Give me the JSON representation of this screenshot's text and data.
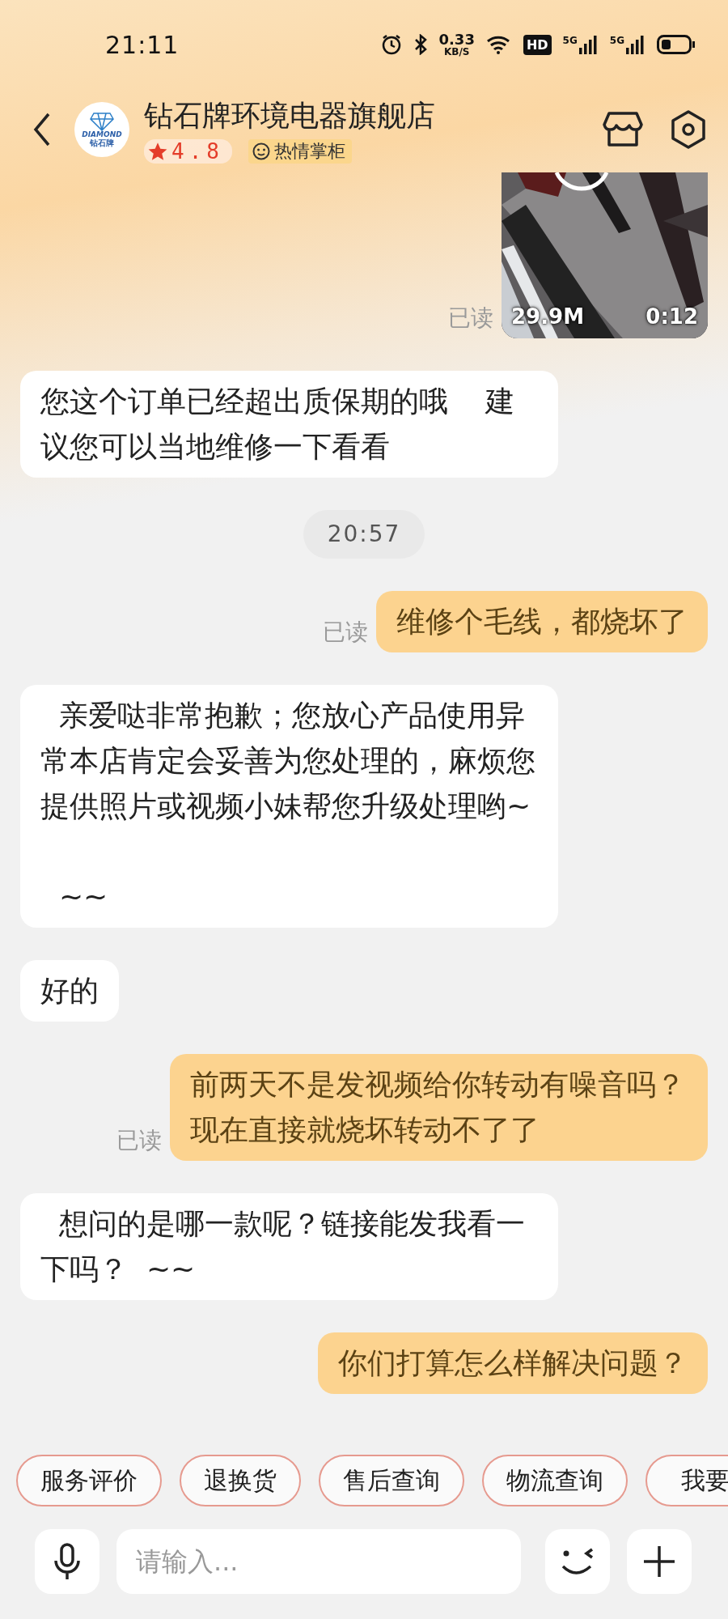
{
  "status_bar": {
    "time": "21:11",
    "speed": "0.33",
    "speed_unit": "KB/S",
    "hd": "HD",
    "networks": [
      "5G",
      "5G"
    ]
  },
  "header": {
    "logo_top": "DIAMOND",
    "logo_bottom": "钻石牌",
    "title": "钻石牌环境电器旗舰店",
    "rating": "4.8",
    "badge": "热情掌柜"
  },
  "messages": [
    {
      "kind": "video",
      "sent": true,
      "size": "29.9M",
      "duration": "0:12",
      "status": "已读"
    },
    {
      "kind": "text",
      "sent": false,
      "text": "您这个订单已经超出质保期的哦    建议您可以当地维修一下看看"
    },
    {
      "kind": "time",
      "text": "20:57"
    },
    {
      "kind": "text",
      "sent": true,
      "text": "维修个毛线，都烧坏了",
      "status": "已读"
    },
    {
      "kind": "text",
      "sent": false,
      "text": "  亲爱哒非常抱歉；您放心产品使用异常本店肯定会妥善为您处理的，麻烦您提供照片或视频小妹帮您升级处理哟~\n\n  ~~"
    },
    {
      "kind": "text",
      "sent": false,
      "text": "好的"
    },
    {
      "kind": "text",
      "sent": true,
      "text": "前两天不是发视频给你转动有噪音吗？现在直接就烧坏转动不了了",
      "status": "已读"
    },
    {
      "kind": "text",
      "sent": false,
      "text": "  想问的是哪一款呢？链接能发我看一下吗？  ~~"
    },
    {
      "kind": "text",
      "sent": true,
      "text": "你们打算怎么样解决问题？"
    }
  ],
  "quick_actions": [
    "服务评价",
    "退换货",
    "售后查询",
    "物流查询",
    "我要"
  ],
  "input": {
    "placeholder": "请输入..."
  }
}
